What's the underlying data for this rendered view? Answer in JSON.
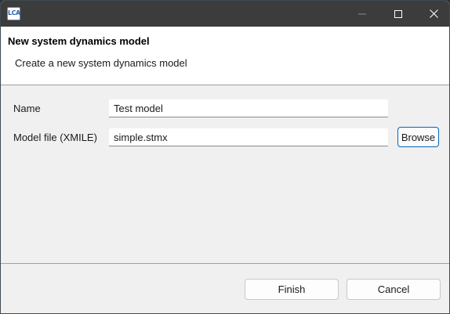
{
  "titlebar": {
    "app_icon_text": "LCA",
    "app_icon": "lca-app-icon",
    "controls": {
      "minimize_icon": "minimize-icon",
      "maximize_icon": "maximize-icon",
      "close_icon": "close-icon"
    }
  },
  "header": {
    "title": "New system dynamics model",
    "description": "Create a new system dynamics model"
  },
  "form": {
    "name_label": "Name",
    "name_value": "Test model",
    "file_label": "Model file (XMILE)",
    "file_value": "simple.stmx",
    "browse_label": "Browse"
  },
  "footer": {
    "finish_label": "Finish",
    "cancel_label": "Cancel"
  },
  "colors": {
    "titlebar": "#3c3c3c",
    "dialog_background": "#f0f0f0",
    "header_background": "#ffffff",
    "focus_accent": "#0067c0"
  }
}
